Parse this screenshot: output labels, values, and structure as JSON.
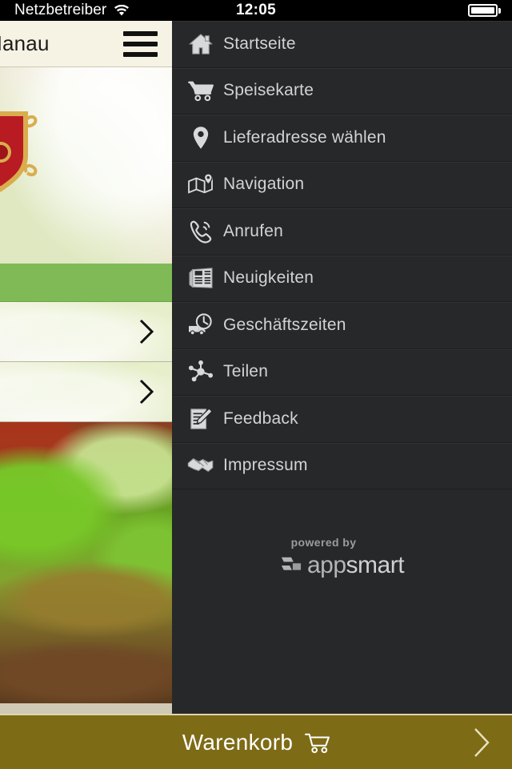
{
  "status_bar": {
    "carrier": "Netzbetreiber",
    "time": "12:05",
    "wifi_icon": "wifi-icon",
    "battery_icon": "battery-full-icon"
  },
  "underlying_app": {
    "header": {
      "title": "Hanau",
      "menu_icon": "hamburger-menu-icon"
    },
    "hero": {
      "logo_icon": "restaurant-crest-logo"
    },
    "green_band": {
      "color": "#7fba56"
    },
    "rows": [
      {
        "chevron_icon": "chevron-right-icon"
      },
      {
        "chevron_icon": "chevron-right-icon"
      }
    ]
  },
  "drawer": {
    "background_color": "#262829",
    "menu": [
      {
        "label": "Startseite",
        "icon": "home-icon"
      },
      {
        "label": "Speisekarte",
        "icon": "shopping-cart-icon"
      },
      {
        "label": "Lieferadresse wählen",
        "icon": "map-pin-icon"
      },
      {
        "label": "Navigation",
        "icon": "map-navigation-icon"
      },
      {
        "label": "Anrufen",
        "icon": "phone-call-icon"
      },
      {
        "label": "Neuigkeiten",
        "icon": "newspaper-icon"
      },
      {
        "label": "Geschäftszeiten",
        "icon": "delivery-clock-icon"
      },
      {
        "label": "Teilen",
        "icon": "share-network-icon"
      },
      {
        "label": "Feedback",
        "icon": "document-pen-icon"
      },
      {
        "label": "Impressum",
        "icon": "handshake-icon"
      }
    ],
    "branding": {
      "powered_by": "powered by",
      "brand_first": "app",
      "brand_second": "smart",
      "logo_icon": "appsmart-logo-icon"
    }
  },
  "bottom_bar": {
    "label": "Warenkorb",
    "cart_icon": "shopping-cart-icon",
    "chevron_icon": "chevron-right-icon",
    "background_color": "#7d6b16"
  }
}
